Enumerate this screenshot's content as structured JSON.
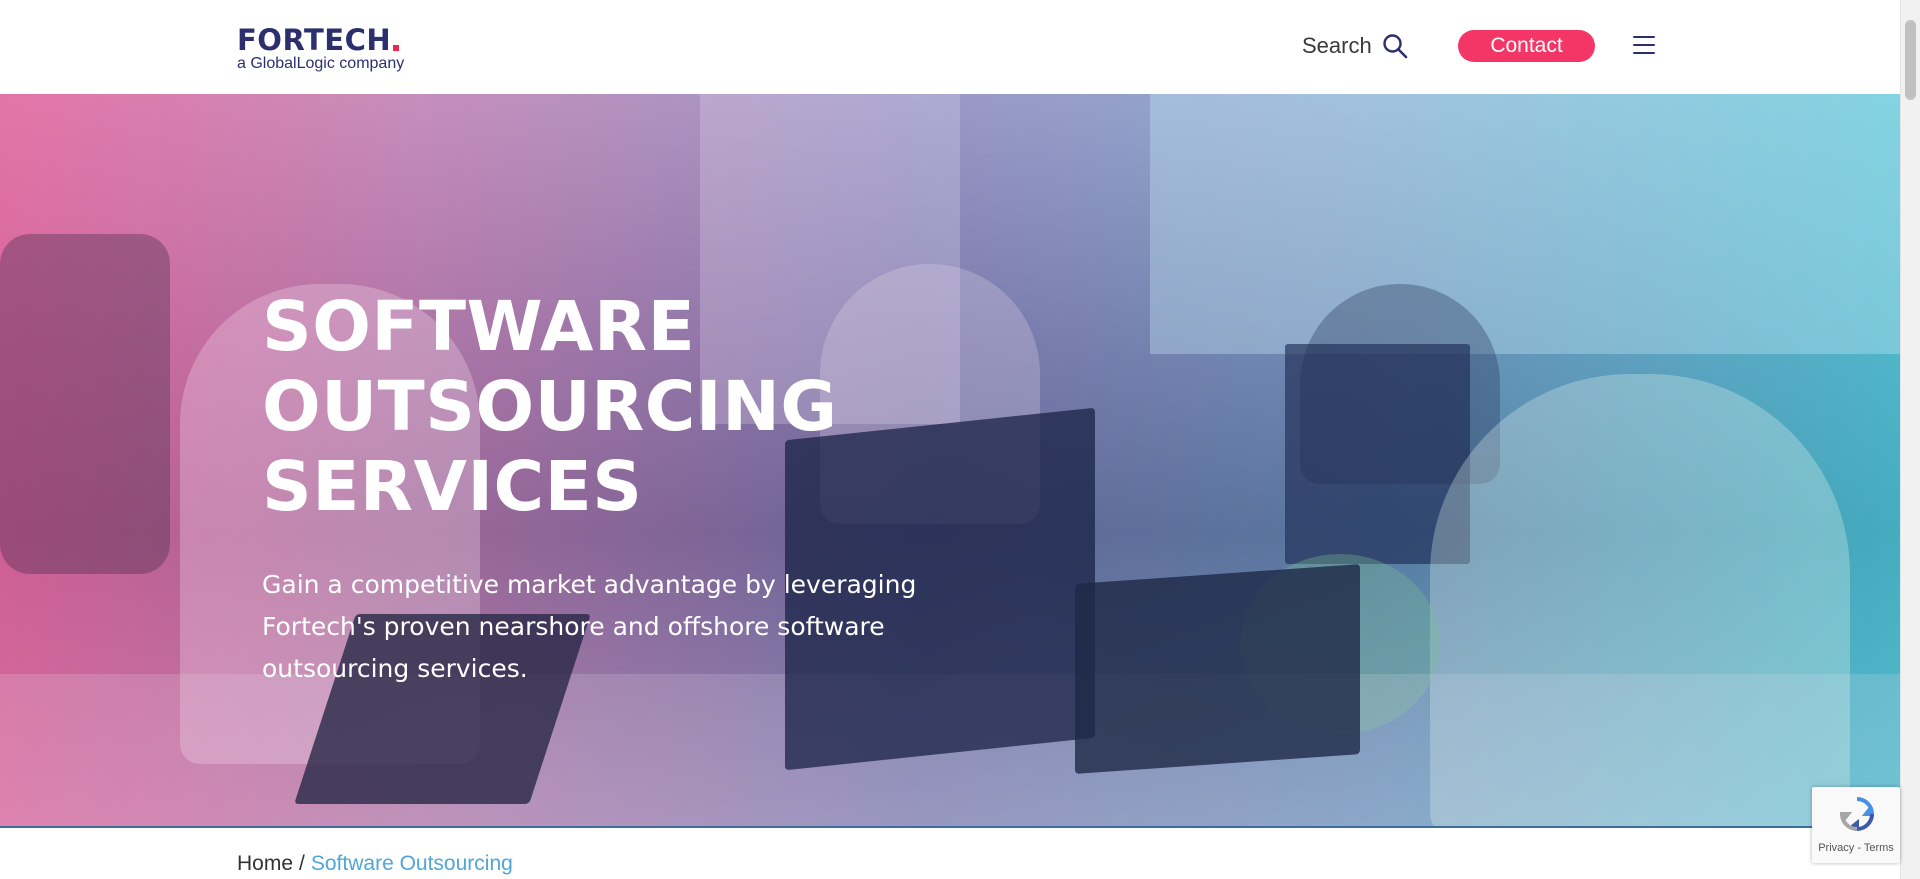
{
  "header": {
    "logo_main": "FORTECH",
    "logo_sub": "a GlobalLogic company",
    "search_label": "Search",
    "contact_label": "Contact",
    "icons": {
      "search": "search-icon",
      "menu": "hamburger-menu-icon"
    }
  },
  "hero": {
    "title_lines": [
      "SOFTWARE",
      "OUTSOURCING",
      "SERVICES"
    ],
    "description": "Gain a competitive market advantage by leveraging Fortech's proven nearshore and offshore software outsourcing services."
  },
  "breadcrumb": {
    "home": "Home",
    "separator": "/",
    "current": "Software Outsourcing"
  },
  "recaptcha": {
    "privacy": "Privacy",
    "separator": " - ",
    "terms": "Terms"
  },
  "colors": {
    "brand_navy": "#2c2f6e",
    "accent_pink": "#f33665",
    "link_blue": "#4fa6d8"
  }
}
